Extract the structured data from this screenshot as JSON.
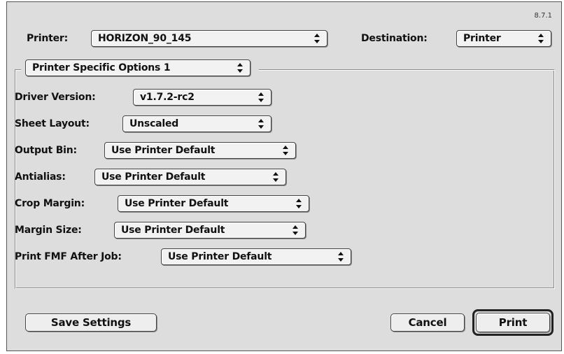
{
  "version_label": "8.7.1",
  "printer": {
    "label": "Printer:",
    "value": "HORIZON_90_145"
  },
  "destination": {
    "label": "Destination:",
    "value": "Printer"
  },
  "panel": {
    "value": "Printer Specific Options 1"
  },
  "options": [
    {
      "label": "Driver Version:",
      "value": "v1.7.2-rc2"
    },
    {
      "label": "Sheet Layout:",
      "value": "Unscaled"
    },
    {
      "label": "Output Bin:",
      "value": "Use Printer Default"
    },
    {
      "label": "Antialias:",
      "value": "Use Printer Default"
    },
    {
      "label": "Crop Margin:",
      "value": "Use Printer Default"
    },
    {
      "label": "Margin Size:",
      "value": "Use Printer Default"
    },
    {
      "label": "Print FMF After Job:",
      "value": "Use Printer Default"
    }
  ],
  "buttons": {
    "save_settings": "Save Settings",
    "cancel": "Cancel",
    "print": "Print"
  },
  "icons": {
    "popup_arrows": "up-down-arrows-icon"
  },
  "colors": {
    "dialog_bg": "#dddddd",
    "control_bg": "#f2f2f2",
    "text": "#111111"
  }
}
